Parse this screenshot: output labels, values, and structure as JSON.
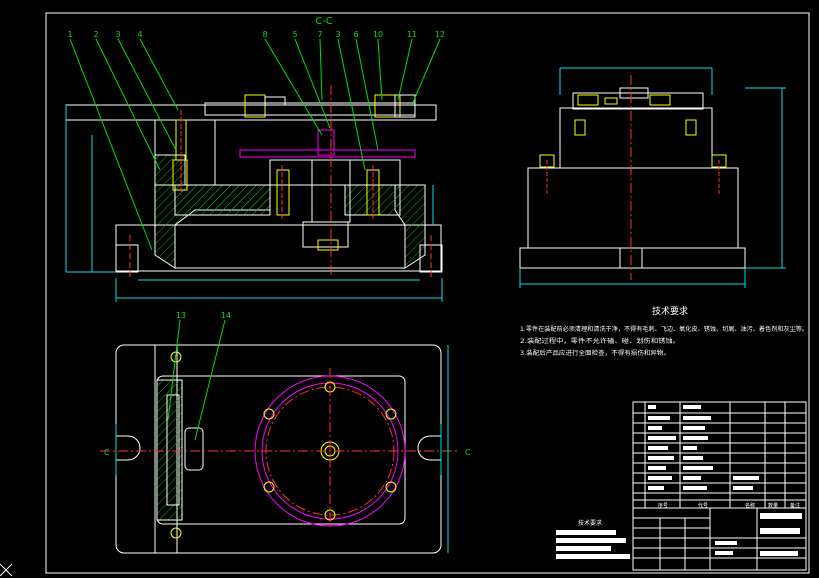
{
  "section_title": "C-C",
  "section_mark": "C",
  "part_callouts_top": [
    "1",
    "2",
    "3",
    "4",
    "8",
    "5",
    "7",
    "3",
    "6",
    "10",
    "11",
    "12"
  ],
  "part_callouts_plan": [
    "13",
    "14"
  ],
  "tech_requirements": {
    "title": "技术要求",
    "items": [
      "1.零件在装配前必须清理和清洗干净，不得有毛刺、飞边、氧化皮、锈蚀、切屑、油污、着色剂和灰尘等。",
      "2.装配过程中，零件不允许磕、碰、划伤和锈蚀。",
      "3.装配后产品应进行全面检查，不得有损伤和异物。"
    ]
  },
  "title_block": {
    "header_cells": [
      "序号",
      "代号",
      "名称",
      "数量",
      "备注"
    ]
  },
  "stamp_label": "技术要求",
  "colors": {
    "background": "#000000",
    "frame": "#ffffff",
    "outline": "#ffffff",
    "centerline": "#ff3030",
    "hatch": "#00c000",
    "dimension": "#00e0e0",
    "leader": "#00e000",
    "fixture_part": "#ff00ff",
    "bolt": "#ffff00",
    "text": "#ffffff"
  },
  "icons": [
    "crosshair-cursor-icon"
  ]
}
